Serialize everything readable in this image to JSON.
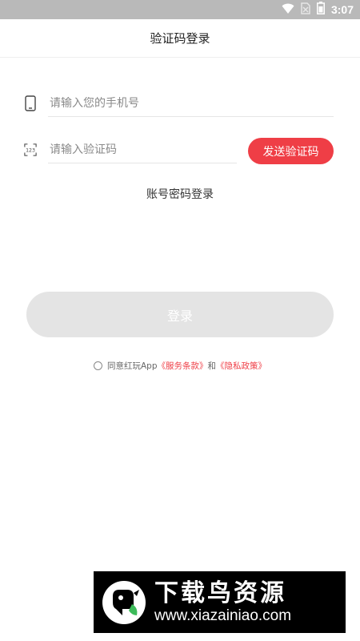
{
  "status_bar": {
    "time": "3:07",
    "icons": [
      "wifi-icon",
      "no-sim-icon",
      "battery-icon"
    ]
  },
  "header": {
    "title": "验证码登录"
  },
  "phone_field": {
    "icon": "phone-icon",
    "placeholder": "请输入您的手机号",
    "value": ""
  },
  "code_field": {
    "icon": "code-123-icon",
    "placeholder": "请输入验证码",
    "value": "",
    "send_button_label": "发送验证码"
  },
  "password_login_label": "账号密码登录",
  "login_button_label": "登录",
  "agreement": {
    "prefix": "同意红玩App",
    "service_terms": "《服务条款》",
    "conjunction": "和",
    "privacy_policy": "《隐私政策》",
    "checked": false
  },
  "watermark": {
    "title": "下载鸟资源",
    "url": "www.xiazainiao.com"
  },
  "colors": {
    "accent": "#ef3e46",
    "status_bar": "#b9b9b9",
    "login_disabled": "#e4e4e4"
  }
}
